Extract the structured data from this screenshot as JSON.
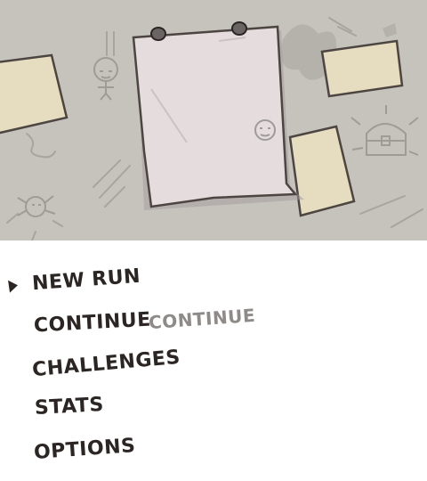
{
  "menu": {
    "items": [
      {
        "id": "new-run",
        "label": "NEW RUN",
        "selected": true
      },
      {
        "id": "continue",
        "label": "CONTINUE",
        "selected": false
      },
      {
        "id": "challenges",
        "label": "CHALLENGES",
        "selected": false
      },
      {
        "id": "stats",
        "label": "STATS",
        "selected": false
      },
      {
        "id": "options",
        "label": "OPTIONS",
        "selected": false
      }
    ],
    "continue_preview": "CONTINUE",
    "cursor_icon": "triangle-pointer-icon"
  },
  "colors": {
    "background_wall": "#c6c3bd",
    "paper_main": "#e4dcdd",
    "paper_note": "#e6dcc0",
    "menu_text": "#2b2523",
    "menu_text_disabled": "#8d8a88"
  }
}
